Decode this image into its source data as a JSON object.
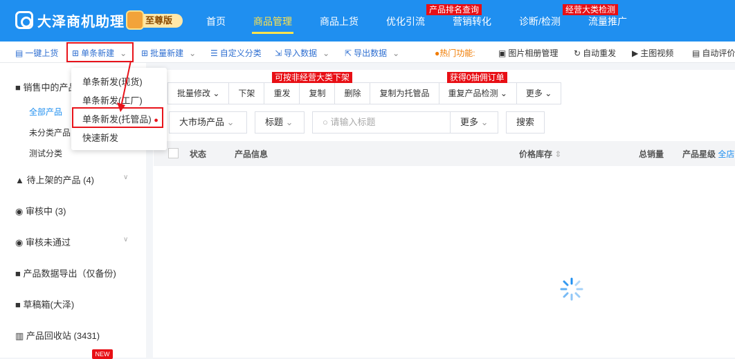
{
  "header": {
    "app_name": "大泽商机助理",
    "edition_badge": "至尊版",
    "nav": [
      "首页",
      "商品管理",
      "商品上货",
      "优化引流",
      "营销转化",
      "诊断/检测",
      "流量推广"
    ],
    "active_nav": "商品管理",
    "tags": {
      "ranking": "产品排名查询",
      "inspection": "经营大类检测"
    }
  },
  "toolbar": {
    "one_click": "一键上货",
    "single_new": "单条新建",
    "batch_new": "批量新建",
    "custom_category": "自定义分类",
    "import_data": "导入数据",
    "export_data": "导出数据",
    "hot": "热门功能:",
    "album": "图片相册管理",
    "auto_repost": "自动重发",
    "main_video": "主图视频",
    "auto_review": "自动评价"
  },
  "dropdown": {
    "items": [
      "单条新发(现货)",
      "单条新发(工厂)",
      "单条新发(托管品)",
      "快速新发"
    ]
  },
  "sidebar": {
    "on_sale": "销售中的产品",
    "sub": [
      "全部产品",
      "未分类产品",
      "测试分类"
    ],
    "pending": "待上架的产品 (4)",
    "reviewing": "审核中 (3)",
    "rejected": "审核未通过",
    "export": "产品数据导出（仅备份)",
    "drafts": "草稿箱(大泽)",
    "recycle": "产品回收站 (3431)",
    "new_tag": "NEW"
  },
  "actions": {
    "batch_modify": "批量修改",
    "unlist": "下架",
    "repost": "重发",
    "copy": "复制",
    "delete": "删除",
    "copy_hosted": "复制为托管品",
    "dup_check": "重复产品检测",
    "more": "更多",
    "tag_unlist": "可按非经营大类下架",
    "tag_commission": "获得0抽佣订单"
  },
  "filters": {
    "market": "大市场产品",
    "title": "标题",
    "search_placeholder": "请输入标题",
    "more": "更多",
    "search_btn": "搜索"
  },
  "table": {
    "headers": [
      "状态",
      "产品信息",
      "价格库存",
      "总销量",
      "产品星级"
    ],
    "all_stores": "全店"
  },
  "colors": {
    "brand": "#1f8ff0",
    "highlight": "#e8131a",
    "active_nav": "#ffe34d"
  }
}
